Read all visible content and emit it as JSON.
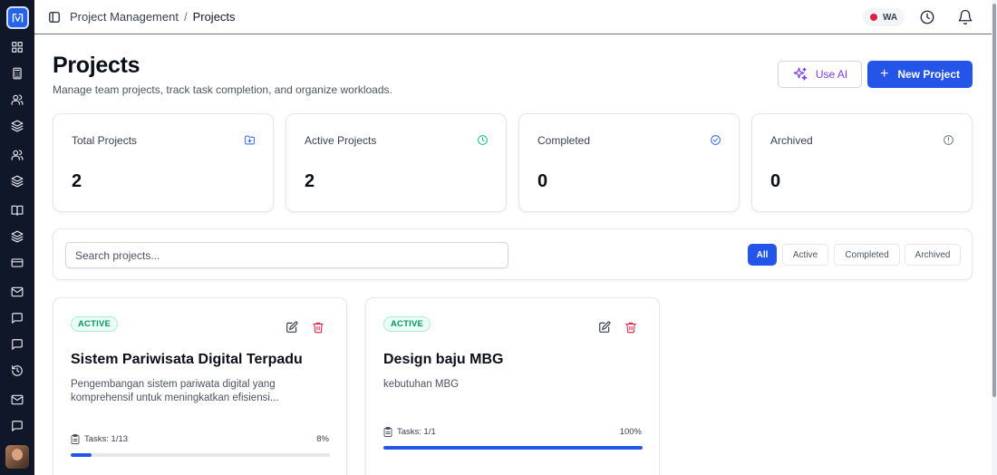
{
  "breadcrumb": {
    "parent": "Project Management",
    "separator": "/",
    "current": "Projects"
  },
  "topbar": {
    "whatsapp_badge": "WA",
    "icons": [
      "toggle-sidebar-icon",
      "history-icon",
      "bell-icon"
    ]
  },
  "sidebar": {
    "icons": [
      "dashboard-icon",
      "calculator-icon",
      "users-icon",
      "layers-icon",
      "users-icon",
      "layers-icon",
      "book-icon",
      "layers-icon",
      "credit-card-icon",
      "mail-icon",
      "message-icon",
      "message-icon",
      "history-icon",
      "mail-icon",
      "message-icon"
    ]
  },
  "header": {
    "title": "Projects",
    "subtitle": "Manage team projects, track task completion, and organize workloads.",
    "ai_button": "Use AI",
    "new_button": "New Project"
  },
  "stats": [
    {
      "label": "Total Projects",
      "value": "2",
      "icon": "folder-icon",
      "color": "#2563eb"
    },
    {
      "label": "Active Projects",
      "value": "2",
      "icon": "clock-icon",
      "color": "#10b981"
    },
    {
      "label": "Completed",
      "value": "0",
      "icon": "check-circle-icon",
      "color": "#2563eb"
    },
    {
      "label": "Archived",
      "value": "0",
      "icon": "alert-circle-icon",
      "color": "#6b7280"
    }
  ],
  "filters": {
    "search_placeholder": "Search projects...",
    "search_value": "",
    "options": [
      "All",
      "Active",
      "Completed",
      "Archived"
    ],
    "selected": "All"
  },
  "projects": [
    {
      "status": "ACTIVE",
      "name": "Sistem Pariwisata Digital Terpadu",
      "description": "Pengembangan sistem pariwata digital yang komprehensif untuk meningkatkan efisiensi...",
      "tasks_label": "Tasks: 1/13",
      "progress_label": "8%",
      "progress": 0.08
    },
    {
      "status": "ACTIVE",
      "name": "Design baju MBG",
      "description": "kebutuhan MBG",
      "tasks_label": "Tasks: 1/1",
      "progress_label": "100%",
      "progress": 1.0
    }
  ],
  "colors": {
    "sidebar": "#0f1729",
    "primary": "#2554e8",
    "ai": "#7c3aed",
    "active_status": "#059669",
    "danger": "#e11d48"
  }
}
